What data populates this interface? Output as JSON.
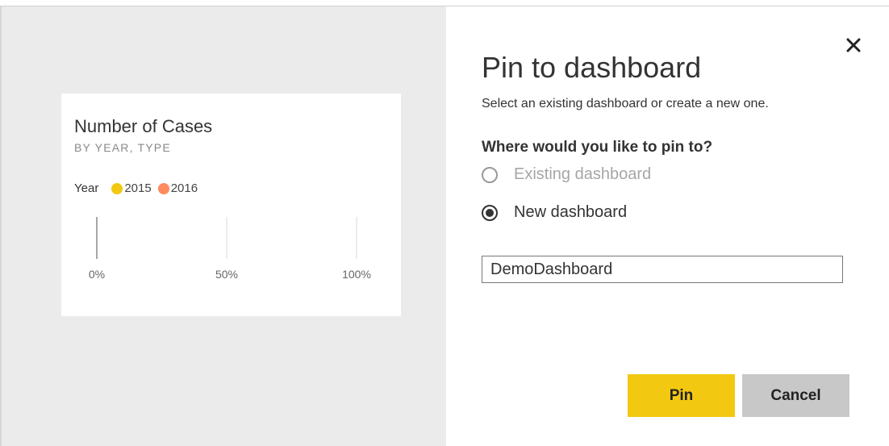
{
  "tile": {
    "title": "Number of Cases",
    "subtitle": "BY YEAR, TYPE",
    "legend_title": "Year",
    "legend": [
      {
        "label": "2015",
        "color": "#f2c811"
      },
      {
        "label": "2016",
        "color": "#fd8b5d"
      }
    ]
  },
  "chart_data": {
    "type": "bar",
    "title": "Number of Cases",
    "subtitle": "BY YEAR, TYPE",
    "legend_title": "Year",
    "series": [
      {
        "name": "2015",
        "color": "#f2c811",
        "values": []
      },
      {
        "name": "2016",
        "color": "#fd8b5d",
        "values": []
      }
    ],
    "orientation": "horizontal",
    "x_ticks": [
      "0%",
      "50%",
      "100%"
    ],
    "x_tick_values": [
      0,
      0.5,
      1
    ],
    "xlim": [
      0,
      1
    ],
    "grid": true
  },
  "dialog": {
    "title": "Pin to dashboard",
    "description": "Select an existing dashboard or create a new one.",
    "question": "Where would you like to pin to?",
    "options": [
      {
        "label": "Existing dashboard",
        "selected": false,
        "disabled": true
      },
      {
        "label": "New dashboard",
        "selected": true,
        "disabled": false
      }
    ],
    "dashboard_name_value": "DemoDashboard",
    "pin_label": "Pin",
    "cancel_label": "Cancel",
    "close_icon": "close-icon",
    "accent": "#f2c811"
  }
}
